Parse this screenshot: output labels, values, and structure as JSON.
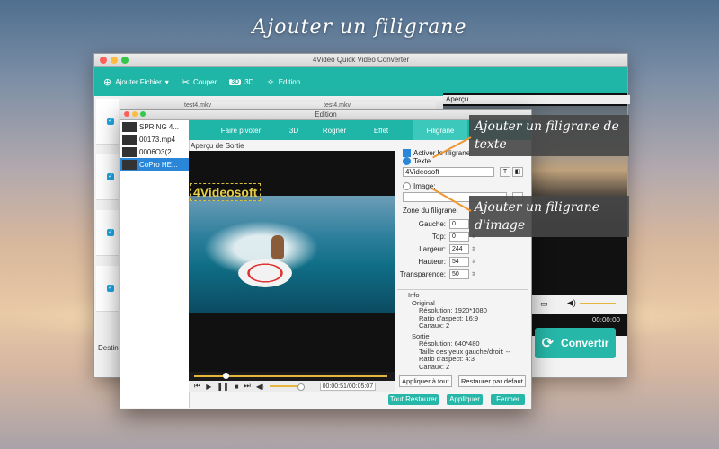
{
  "headline": "Ajouter un filigrane",
  "main_window": {
    "title": "4Video Quick Video Converter",
    "toolbar": {
      "add_file": "Ajouter Fichier",
      "cut": "Couper",
      "three_d_badge": "3D",
      "three_d": "3D",
      "edit": "Edition"
    },
    "col_head_1": "test4.mkv",
    "col_head_2": "test4.mkv",
    "preview_label": "Aperçu",
    "preview_time": "00:00:00",
    "destination_label": "Destin",
    "convert_button": "Convertir"
  },
  "edition_dialog": {
    "title": "Edition",
    "files": [
      {
        "name": "SPRING 4..."
      },
      {
        "name": "00173.mp4"
      },
      {
        "name": "0006O3(2..."
      },
      {
        "name": "CoPro HE..."
      }
    ],
    "tabs": [
      "Faire pivoter",
      "3D",
      "Rogner",
      "Effet",
      "Filigrane"
    ],
    "active_tab": "Filigrane",
    "output_preview_label": "Aperçu de Sortie",
    "watermark_overlay": "4Videosoft",
    "time_display": "00:00:51/00:05:07",
    "enable_watermark": "Activer le filigrane",
    "text_option": "Texte",
    "text_value": "4Videosoft",
    "image_option": "Image:",
    "zone_label": "Zone du filigrane:",
    "fields": [
      {
        "label": "Gauche:",
        "value": "0"
      },
      {
        "label": "Top:",
        "value": "0"
      },
      {
        "label": "Largeur:",
        "value": "244"
      },
      {
        "label": "Hauteur:",
        "value": "54"
      },
      {
        "label": "Transparence:",
        "value": "50"
      }
    ],
    "info": {
      "title": "Info",
      "original_label": "Original",
      "orig_resolution": "Résolution: 1920*1080",
      "orig_ratio": "Ratio d'aspect: 16:9",
      "orig_channels": "Canaux: 2",
      "output_label": "Sortie",
      "out_resolution": "Résolution: 640*480",
      "out_eyes": "Taille des yeux gauche/droit: --",
      "out_ratio": "Ratio d'aspect: 4:3",
      "out_channels": "Canaux: 2"
    },
    "apply_all": "Appliquer à tout",
    "restore_default": "Restaurer par défaut",
    "restore_all": "Tout Restaurer",
    "apply": "Appliquer",
    "close": "Fermer"
  },
  "callouts": {
    "text_watermark": "Ajouter un filigrane de texte",
    "image_watermark": "Ajouter un filigrane d'image"
  },
  "colors": {
    "accent": "#1fb6a8",
    "selection": "#2a86d8",
    "arrow": "#f0962f"
  }
}
